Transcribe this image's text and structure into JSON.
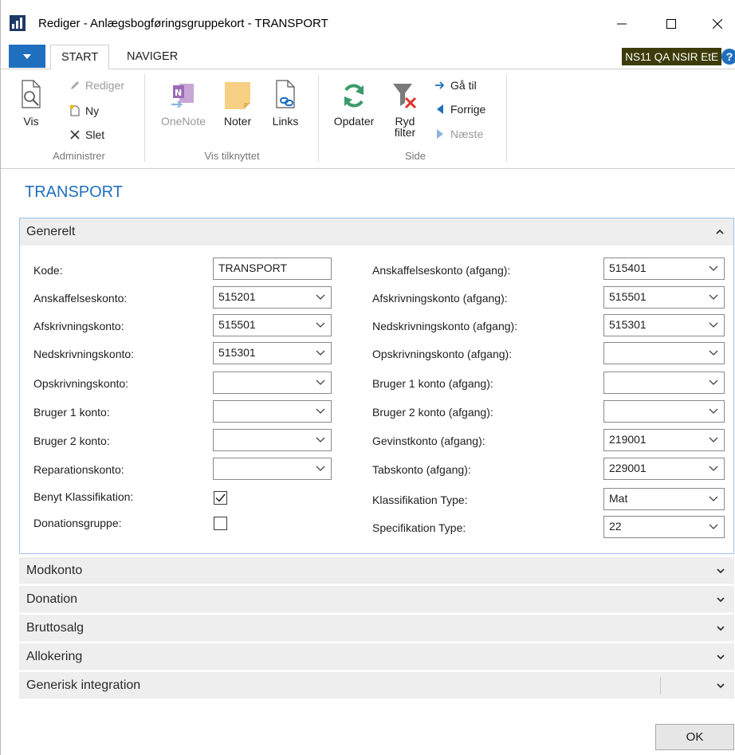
{
  "window": {
    "title": "Rediger - Anlægsbogføringsgruppekort - TRANSPORT",
    "controls": {
      "minimize": "—",
      "maximize": "☐",
      "close": "✕"
    }
  },
  "ribbon": {
    "tabs": [
      {
        "label": "START"
      },
      {
        "label": "NAVIGER"
      }
    ],
    "company_badge": "NS11 QA NSIR EtE",
    "help_label": "?",
    "groups": {
      "administrer": {
        "label": "Administrer",
        "vis": "Vis",
        "rediger": "Rediger",
        "ny": "Ny",
        "slet": "Slet"
      },
      "vis_tilknyttet": {
        "label": "Vis tilknyttet",
        "onenote": "OneNote",
        "noter": "Noter",
        "links": "Links"
      },
      "side": {
        "label": "Side",
        "opdater": "Opdater",
        "ryd_filter_1": "Ryd",
        "ryd_filter_2": "filter",
        "gaa_til": "Gå til",
        "forrige": "Forrige",
        "naeste": "Næste"
      }
    }
  },
  "page": {
    "title": "TRANSPORT",
    "generelt": {
      "header": "Generelt",
      "left": [
        {
          "label": "Kode:",
          "value": "TRANSPORT",
          "type": "text"
        },
        {
          "label": "Anskaffelseskonto:",
          "value": "515201",
          "type": "dropdown"
        },
        {
          "label": "Afskrivningskonto:",
          "value": "515501",
          "type": "dropdown"
        },
        {
          "label": "Nedskrivningskonto:",
          "value": "515301",
          "type": "dropdown"
        },
        {
          "label": "Opskrivningskonto:",
          "value": "",
          "type": "dropdown"
        },
        {
          "label": "Bruger 1 konto:",
          "value": "",
          "type": "dropdown"
        },
        {
          "label": "Bruger 2 konto:",
          "value": "",
          "type": "dropdown"
        },
        {
          "label": "Reparationskonto:",
          "value": "",
          "type": "dropdown"
        }
      ],
      "checkboxes": [
        {
          "label": "Benyt Klassifikation:",
          "checked": true
        },
        {
          "label": "Donationsgruppe:",
          "checked": false
        }
      ],
      "right": [
        {
          "label": "Anskaffelseskonto (afgang):",
          "value": "515401"
        },
        {
          "label": "Afskrivningskonto (afgang):",
          "value": "515501"
        },
        {
          "label": "Nedskrivningskonto (afgang):",
          "value": "515301"
        },
        {
          "label": "Opskrivningskonto (afgang):",
          "value": ""
        },
        {
          "label": "Bruger 1 konto (afgang):",
          "value": ""
        },
        {
          "label": "Bruger 2 konto (afgang):",
          "value": ""
        },
        {
          "label": "Gevinstkonto (afgang):",
          "value": "219001"
        },
        {
          "label": "Tabskonto (afgang):",
          "value": "229001"
        },
        {
          "label": "Klassifikation Type:",
          "value": "Mat"
        },
        {
          "label": "Specifikation Type:",
          "value": "22"
        }
      ]
    },
    "collapsed_tabs": [
      {
        "label": "Modkonto"
      },
      {
        "label": "Donation"
      },
      {
        "label": "Bruttosalg"
      },
      {
        "label": "Allokering"
      },
      {
        "label": "Generisk integration"
      }
    ],
    "ok_label": "OK"
  },
  "colors": {
    "accent": "#1f6fbf",
    "badge": "#3c3c0a",
    "fasttab_bg": "#eeeeee",
    "fasttab_border": "#9fc3e8"
  }
}
